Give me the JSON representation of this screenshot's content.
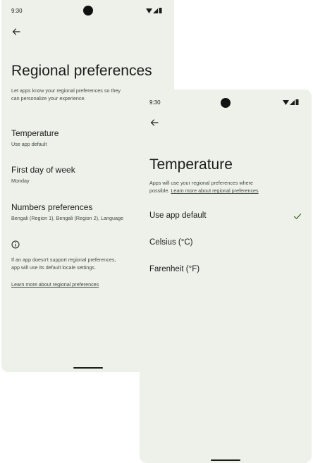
{
  "screen_back": {
    "status": {
      "time": "9:30"
    },
    "title": "Regional preferences",
    "description_line1": "Let apps know your regional preferences so they",
    "description_line2": "can personalize your experience.",
    "items": [
      {
        "title": "Temperature",
        "subtitle": "Use app default"
      },
      {
        "title": "First day of week",
        "subtitle": "Monday"
      },
      {
        "title": "Numbers preferences",
        "subtitle": "Bengali (Region 1), Bengali (Region 2), Language"
      }
    ],
    "info_line1": "If an app doesn't support regional preferences,",
    "info_line2": "app will use its default locale settings.",
    "learn_more": "Learn more about regional preferences"
  },
  "screen_front": {
    "status": {
      "time": "9:30"
    },
    "title": "Temperature",
    "description_line1": "Apps will use your regional preferences where",
    "description_prefix": "possible. ",
    "description_link": "Learn more about regional preferences",
    "options": [
      {
        "label": "Use app default",
        "selected": true
      },
      {
        "label": "Celsius (°C)",
        "selected": false
      },
      {
        "label": "Farenheit (°F)",
        "selected": false
      }
    ]
  },
  "colors": {
    "screen_bg": "#eef1ea",
    "check_color": "#386a20",
    "text_primary": "#1b1c1a",
    "text_secondary": "#3f4a3f"
  },
  "icons": [
    "back-arrow-icon",
    "wifi-icon",
    "cellular-signal-icon",
    "battery-icon",
    "info-icon",
    "checkmark-icon"
  ]
}
